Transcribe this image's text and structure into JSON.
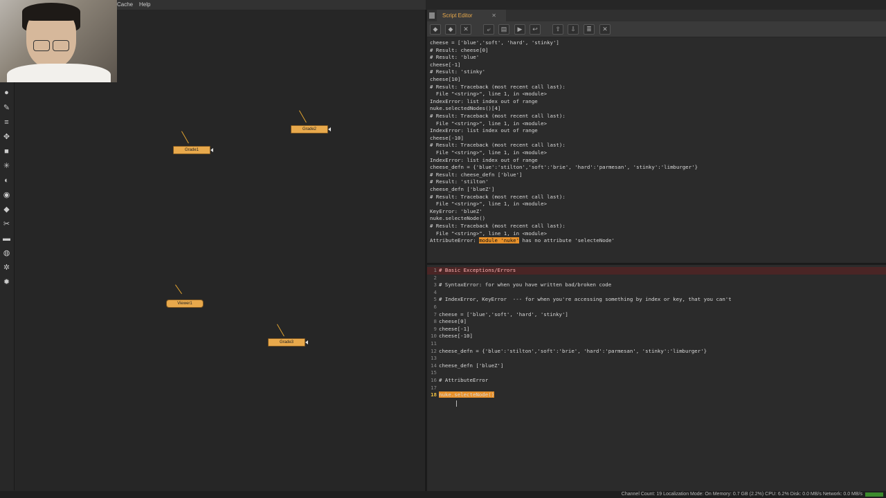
{
  "menu": {
    "cache": "Cache",
    "help": "Help"
  },
  "tools": [
    "circle-icon",
    "paint-icon",
    "layers-icon",
    "transform-icon",
    "cube-icon",
    "particles-icon",
    "d-icon",
    "eye-icon",
    "tag-icon",
    "brush-icon",
    "bar-icon",
    "globe-icon",
    "gear-icon",
    "settings-wheel-icon"
  ],
  "nodes": {
    "grade1": "Grade1",
    "grade2": "Grade2",
    "grade3": "Grade3",
    "viewer1": "Viewer1"
  },
  "script_editor": {
    "tab_label": "Script Editor",
    "tab_close": "✕",
    "toolbar_icons": [
      "prev-icon",
      "next-icon",
      "clear-icon",
      "source-icon",
      "load-icon",
      "run-icon",
      "return-icon",
      "save-up-icon",
      "save-down-icon",
      "list-icon",
      "clear-all-icon"
    ],
    "output_lines": [
      "cheese = ['blue','soft', 'hard', 'stinky']",
      "# Result: cheese[0]",
      "# Result: 'blue'",
      "cheese[-1]",
      "# Result: 'stinky'",
      "cheese[10]",
      "# Result: Traceback (most recent call last):",
      "  File \"<string>\", line 1, in <module>",
      "IndexError: list index out of range",
      "nuke.selectedNodes()[4]",
      "# Result: Traceback (most recent call last):",
      "  File \"<string>\", line 1, in <module>",
      "IndexError: list index out of range",
      "cheese[-10]",
      "# Result: Traceback (most recent call last):",
      "  File \"<string>\", line 1, in <module>",
      "IndexError: list index out of range",
      "cheese_defn = {'blue':'stilton','soft':'brie', 'hard':'parmesan', 'stinky':'limburger'}",
      "# Result: cheese_defn ['blue']",
      "# Result: 'stilton'",
      "cheese_defn ['blueZ']",
      "# Result: Traceback (most recent call last):",
      "  File \"<string>\", line 1, in <module>",
      "KeyError: 'blueZ'",
      "nuke.selecteNode()",
      "# Result: Traceback (most recent call last):",
      "  File \"<string>\", line 1, in <module>"
    ],
    "last_line_prefix": "AttributeError: ",
    "last_line_highlight": "module 'nuke'",
    "last_line_suffix": " has no attribute 'selecteNode'",
    "editor_lines": [
      {
        "n": "1",
        "t": "# Basic Exceptions/Errors"
      },
      {
        "n": "2",
        "t": ""
      },
      {
        "n": "3",
        "t": "# SyntaxError: for when you have written bad/broken code"
      },
      {
        "n": "4",
        "t": ""
      },
      {
        "n": "5",
        "t": "# IndexError, KeyError  --- for when you're accessing something by index or key, that you can't"
      },
      {
        "n": "6",
        "t": ""
      },
      {
        "n": "7",
        "t": "cheese = ['blue','soft', 'hard', 'stinky']"
      },
      {
        "n": "8",
        "t": "cheese[0]"
      },
      {
        "n": "9",
        "t": "cheese[-1]"
      },
      {
        "n": "10",
        "t": "cheese[-10]"
      },
      {
        "n": "11",
        "t": ""
      },
      {
        "n": "12",
        "t": "cheese_defn = {'blue':'stilton','soft':'brie', 'hard':'parmesan', 'stinky':'limburger'}"
      },
      {
        "n": "13",
        "t": ""
      },
      {
        "n": "14",
        "t": "cheese_defn ['blueZ']"
      },
      {
        "n": "15",
        "t": ""
      },
      {
        "n": "16",
        "t": "# AttributeError"
      },
      {
        "n": "17",
        "t": ""
      },
      {
        "n": "18",
        "t": "nuke.selecteNode()"
      }
    ]
  },
  "status": "Channel Count: 19  Localization Mode: On  Memory: 0.7 GB (2.2%)  CPU: 6.2%  Disk: 0.0 MB/s  Network: 0.0 MB/s"
}
